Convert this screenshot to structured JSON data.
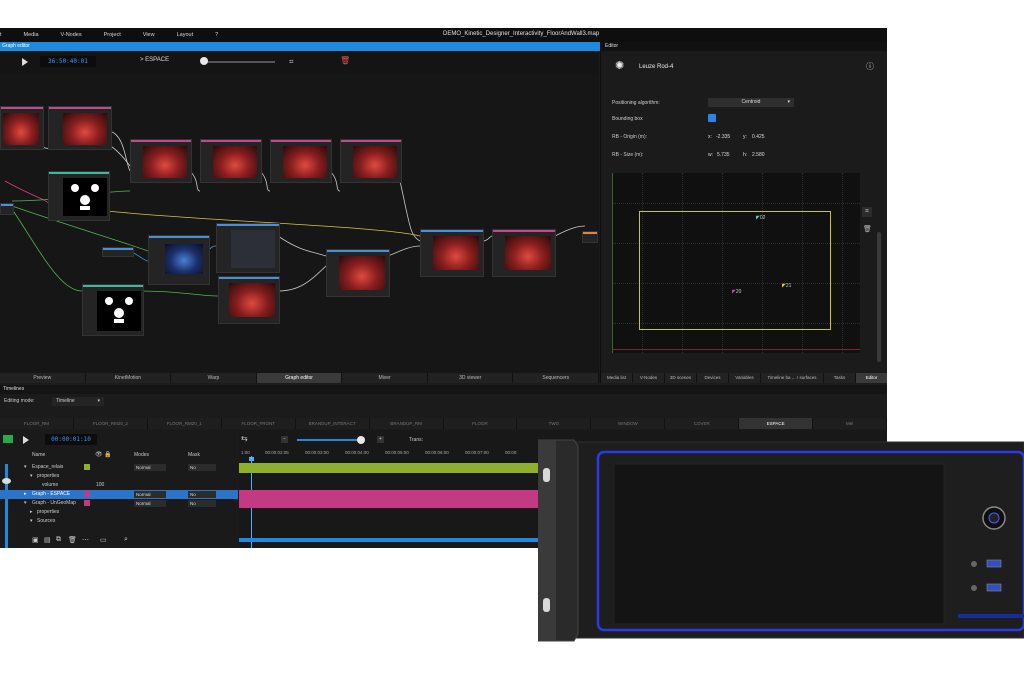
{
  "menu": [
    "t",
    "Media",
    "V-Nodes",
    "Project",
    "View",
    "Layout",
    "?"
  ],
  "window_title": "DEMO_Kinetic_Designer_Interactivity_FloorAndWall3.map",
  "graph_editor": {
    "header": "Graph editor",
    "timecode": "36:50:40:01",
    "scene": "> ESPACE"
  },
  "bottom_tabs": [
    {
      "label": "Preview",
      "active": false
    },
    {
      "label": "KinetMotion",
      "active": false
    },
    {
      "label": "Warp",
      "active": false
    },
    {
      "label": "Graph editor",
      "active": true
    },
    {
      "label": "Mixer",
      "active": false
    },
    {
      "label": "3D viewer",
      "active": false
    },
    {
      "label": "Sequencers",
      "active": false
    }
  ],
  "editor": {
    "header": "Editor",
    "device_name": "Leuze Rod-4",
    "positioning_label": "Positioning algorithm:",
    "positioning_value": "Centroid",
    "bbox_label": "Bounding box",
    "origin_label": "RB - Origin (m):",
    "origin_x_label": "x:",
    "origin_x": "-2.335",
    "origin_y_label": "y:",
    "origin_y": "0.425",
    "size_label": "RB - Size (m):",
    "size_w_label": "w:",
    "size_w": "5.735",
    "size_h_label": "h:",
    "size_h": "2.580",
    "markers": [
      "02",
      "21",
      "20"
    ],
    "tabs": [
      {
        "label": "Media list",
        "active": false
      },
      {
        "label": "V-Nodes",
        "active": false
      },
      {
        "label": "3D scenes",
        "active": false
      },
      {
        "label": "Devices",
        "active": false
      },
      {
        "label": "Variables",
        "active": false
      },
      {
        "label": "Timeline ba ... r surfaces",
        "active": false
      },
      {
        "label": "Tasks",
        "active": false
      },
      {
        "label": "Editor",
        "active": true
      }
    ]
  },
  "timeline": {
    "header": "Timelines",
    "mode_label": "Editing mode:",
    "mode_value": "Timeline",
    "layer_tabs": [
      {
        "label": "FLOOR_RM",
        "active": false
      },
      {
        "label": "FLOOR_RM20_2",
        "active": false
      },
      {
        "label": "FLOOR_RM20_1",
        "active": false
      },
      {
        "label": "FLOOR_FRONT",
        "active": false
      },
      {
        "label": "BRANDUP_INTERACT",
        "active": false
      },
      {
        "label": "BRANDUP_RM",
        "active": false
      },
      {
        "label": "FLOOR",
        "active": false
      },
      {
        "label": "TWO",
        "active": false
      },
      {
        "label": "WINDOW",
        "active": false
      },
      {
        "label": "COVER",
        "active": false
      },
      {
        "label": "ESPACE",
        "active": true
      },
      {
        "label": "Mel",
        "active": false
      }
    ],
    "timecode": "00:00:01:10",
    "speed_label": "Trans:",
    "columns": {
      "name": "Name",
      "modes": "Modes",
      "mask": "Mask"
    },
    "volume_value": "100",
    "rows": [
      {
        "name": "Espace_relais",
        "indent": 0,
        "mode": "Normal",
        "mask": "No",
        "color": "#8fb02c",
        "selected": false
      },
      {
        "name": "properties",
        "indent": 1,
        "mode": "",
        "mask": "",
        "color": "",
        "selected": false
      },
      {
        "name": "volume",
        "indent": 2,
        "mode": "",
        "mask": "",
        "color": "",
        "selected": false
      },
      {
        "name": "Graph - ESPACE",
        "indent": 0,
        "mode": "Normal",
        "mask": "No",
        "color": "#c43a82",
        "selected": true
      },
      {
        "name": "Graph - UnGeoMap",
        "indent": 0,
        "mode": "Normal",
        "mask": "No",
        "color": "#c43a82",
        "selected": false
      },
      {
        "name": "properties",
        "indent": 1,
        "mode": "",
        "mask": "",
        "color": "",
        "selected": false
      },
      {
        "name": "Sources",
        "indent": 1,
        "mode": "",
        "mask": "",
        "color": "",
        "selected": false
      }
    ],
    "ruler": [
      "1:00",
      "00:00:02:05",
      "00:00:03:00",
      "00:00:04:00",
      "00:00:05:00",
      "00:00:06:00",
      "00:00:07:00",
      "00:00:"
    ]
  },
  "colors": {
    "accent": "#1d8ae0",
    "timecode": "#3b97ff",
    "track_green": "#8fb02c",
    "track_pink": "#c43a82",
    "bbox_yellow": "#c9c628",
    "device_led": "#2b3cff"
  }
}
